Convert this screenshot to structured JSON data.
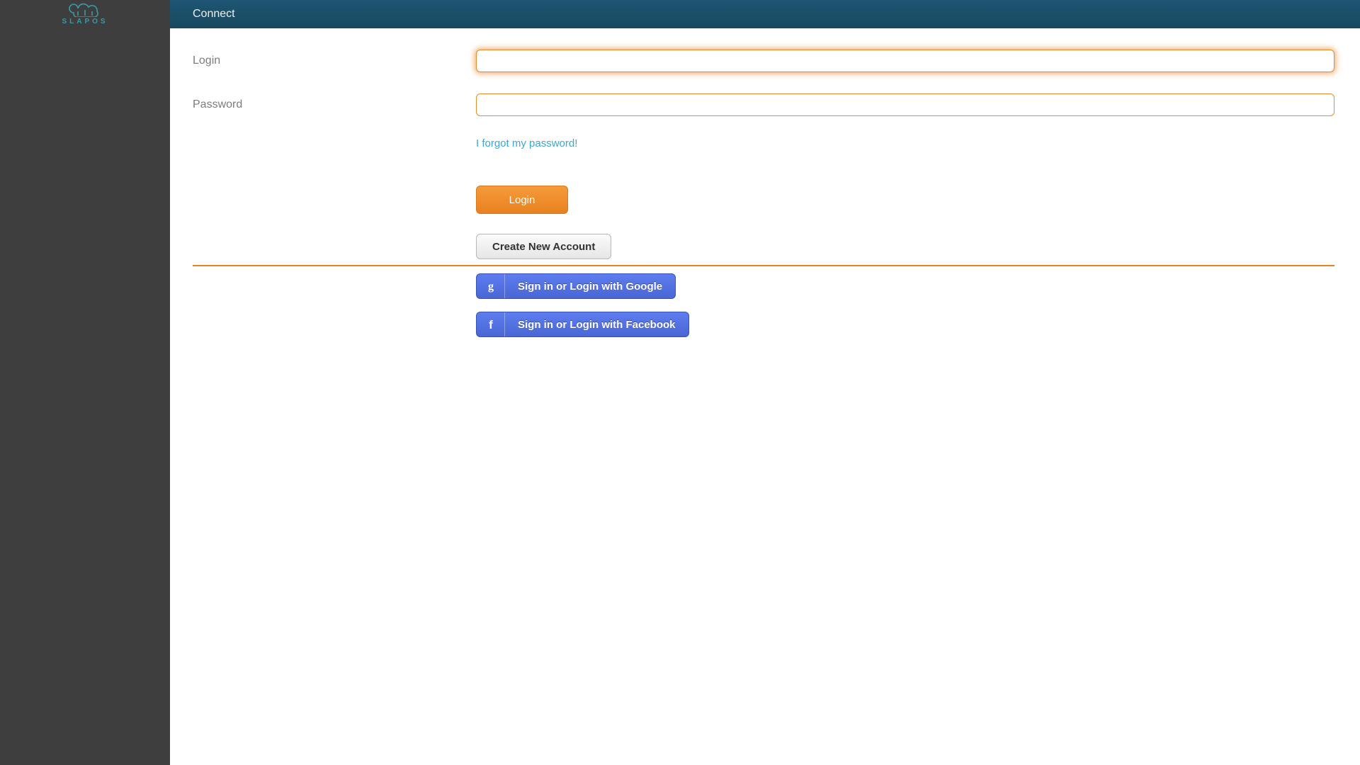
{
  "brand": {
    "name": "SLAPOS"
  },
  "header": {
    "title": "Connect"
  },
  "form": {
    "login_label": "Login",
    "password_label": "Password",
    "login_value": "",
    "password_value": "",
    "forgot_link": "I forgot my password!",
    "login_button": "Login",
    "create_button": "Create New Account"
  },
  "social": {
    "google_label": "Sign in or Login with Google",
    "facebook_label": "Sign in or Login with Facebook"
  },
  "colors": {
    "accent": "#e8811f",
    "sidebar": "#3e3e3e",
    "topbar": "#1d4f6b",
    "link": "#3aa7d4",
    "social": "#4a66d4",
    "brand": "#3a99a6"
  }
}
